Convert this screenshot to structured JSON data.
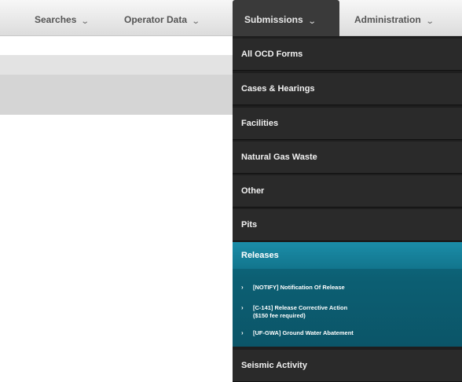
{
  "nav": {
    "searches": "Searches",
    "operator_data": "Operator Data",
    "submissions": "Submissions",
    "administration": "Administration",
    "chevron": "⌄"
  },
  "dropdown": {
    "items": [
      "All OCD Forms",
      "Cases & Hearings",
      "Facilities",
      "Natural Gas Waste",
      "Other",
      "Pits"
    ],
    "releases": {
      "label": "Releases",
      "arrow": "›",
      "sub_items": [
        {
          "line1": "[NOTIFY] Notification Of Release",
          "line2": ""
        },
        {
          "line1": "[C-141] Release Corrective Action",
          "line2": "($150 fee required)"
        },
        {
          "line1": "[UF-GWA] Ground Water Abatement",
          "line2": ""
        }
      ]
    },
    "seismic": "Seismic Activity"
  }
}
